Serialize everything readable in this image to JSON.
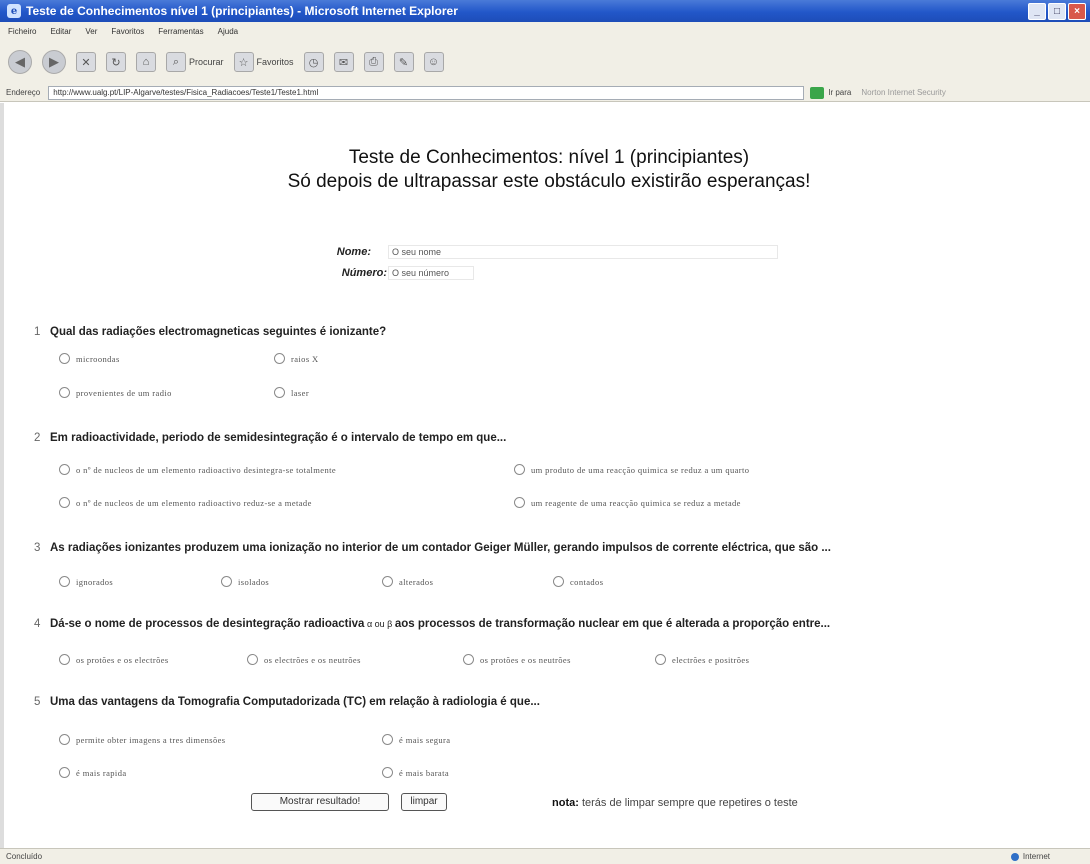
{
  "window": {
    "title": "Teste de Conhecimentos  nível 1 (principiantes) - Microsoft Internet Explorer"
  },
  "menu": [
    "Ficheiro",
    "Editar",
    "Ver",
    "Favoritos",
    "Ferramentas",
    "Ajuda"
  ],
  "toolbar": {
    "search_label": "Procurar",
    "favorites_label": "Favoritos"
  },
  "address": {
    "label": "Endereço",
    "url": "http://www.ualg.pt/LIP-Algarve/testes/Fisica_Radiacoes/Teste1/Teste1.html",
    "go_label": "Ir para",
    "extra": "Norton Internet Security"
  },
  "heading": {
    "line1": "Teste de Conhecimentos: nível 1 (principiantes)",
    "line2": "Só depois de ultrapassar este obstáculo existirão esperanças!"
  },
  "form": {
    "name_label": "Nome:",
    "name_value": "O seu nome",
    "number_label": "Número:",
    "number_value": "O seu número"
  },
  "questions": [
    {
      "number": "1",
      "text": "Qual das radiações electromagneticas seguintes é ionizante?",
      "options": [
        "microondas",
        "raios X",
        "provenientes de um radio",
        "laser"
      ]
    },
    {
      "number": "2",
      "text": "Em radioactividade, periodo de semidesintegração é o intervalo de tempo em que...",
      "options": [
        "o nº de nucleos de um elemento radioactivo desintegra-se totalmente",
        "um produto de uma reacção quimica se reduz a um quarto",
        "o nº de nucleos de um elemento radioactivo reduz-se a metade",
        "um reagente de uma reacção quimica se reduz a metade"
      ]
    },
    {
      "number": "3",
      "text": "As radiações ionizantes produzem uma ionização no interior de um contador Geiger Müller, gerando impulsos de corrente eléctrica, que são ...",
      "options": [
        "ignorados",
        "isolados",
        "alterados",
        "contados"
      ]
    },
    {
      "number": "4",
      "text_a": "Dá-se o nome de processos de desintegração radioactiva",
      "text_mid": " α ou β ",
      "text_b": "aos processos de transformação nuclear em que é alterada a proporção entre...",
      "options": [
        "os protões e os electrões",
        "os electrões e os neutrões",
        "os protões e os neutrões",
        "electrões e positrões"
      ]
    },
    {
      "number": "5",
      "text": "Uma das vantagens da Tomografia Computadorizada (TC) em relação à radiologia é que...",
      "options": [
        "permite obter imagens a tres dimensões",
        "é mais segura",
        "é mais rapida",
        "é mais barata"
      ]
    }
  ],
  "buttons": {
    "show_result": "Mostrar resultado!",
    "clear": "limpar"
  },
  "note": {
    "label": "nota:",
    "text": " terás de limpar sempre que repetires o teste"
  },
  "status": {
    "left": "Concluído",
    "zone": "Internet"
  }
}
